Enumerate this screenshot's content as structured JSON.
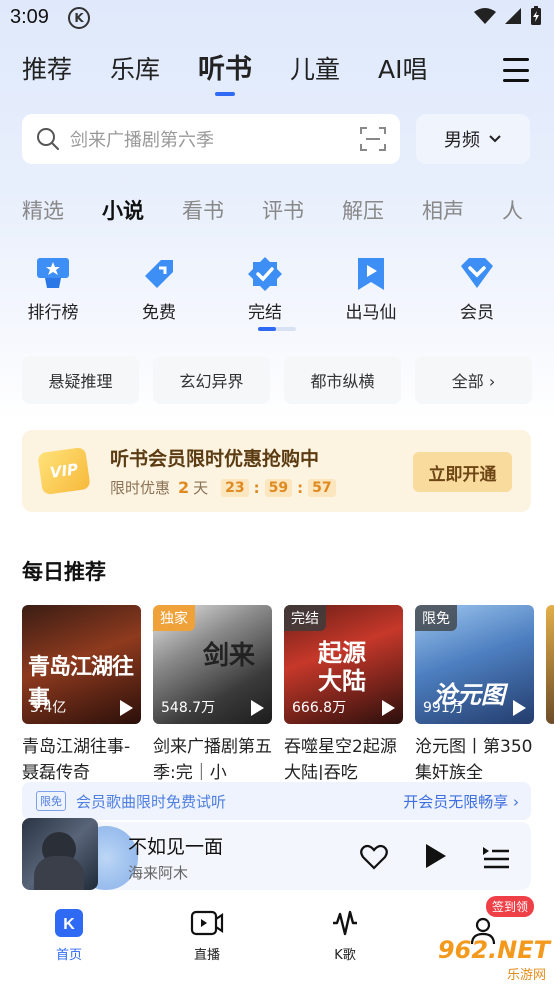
{
  "status": {
    "time": "3:09"
  },
  "top_tabs": [
    {
      "label": "推荐"
    },
    {
      "label": "乐库"
    },
    {
      "label": "听书"
    },
    {
      "label": "儿童"
    },
    {
      "label": "AI唱"
    }
  ],
  "search": {
    "placeholder": "剑来广播剧第六季"
  },
  "gender_filter": {
    "label": "男频"
  },
  "sub_tabs": [
    {
      "label": "精选"
    },
    {
      "label": "小说"
    },
    {
      "label": "看书"
    },
    {
      "label": "评书"
    },
    {
      "label": "解压"
    },
    {
      "label": "相声"
    },
    {
      "label": "人"
    }
  ],
  "categories": [
    {
      "label": "排行榜",
      "icon": "ranking-icon"
    },
    {
      "label": "免费",
      "icon": "free-tag-icon"
    },
    {
      "label": "完结",
      "icon": "finished-check-icon"
    },
    {
      "label": "出马仙",
      "icon": "bookmark-play-icon"
    },
    {
      "label": "会员",
      "icon": "vip-diamond-icon"
    }
  ],
  "chips": [
    {
      "label": "悬疑推理"
    },
    {
      "label": "玄幻异界"
    },
    {
      "label": "都市纵横"
    },
    {
      "label": "全部 ›"
    }
  ],
  "vip_banner": {
    "card_text": "VIP",
    "title": "听书会员限时优惠抢购中",
    "sub_label": "限时优惠",
    "days": "2",
    "days_unit": "天",
    "hours": "23",
    "minutes": "59",
    "seconds": "57",
    "button": "立即开通"
  },
  "daily": {
    "title": "每日推荐",
    "books": [
      {
        "tag": "",
        "plays": "3.4亿",
        "title": "青岛江湖往事-聂磊传奇",
        "cover_text": "青岛江湖往事"
      },
      {
        "tag": "独家",
        "plays": "548.7万",
        "title": "剑来广播剧第五季:完｜小",
        "cover_text": "剑来"
      },
      {
        "tag": "完结",
        "plays": "666.8万",
        "title": "吞噬星空2起源大陆|吞吃",
        "cover_text": "起源大陆"
      },
      {
        "tag": "限免",
        "plays": "991万",
        "title": "沧元图丨第350集奸族全",
        "cover_text": "沧元图"
      }
    ]
  },
  "trial_bar": {
    "badge": "限免",
    "text": "会员歌曲限时免费试听",
    "link": "开会员无限畅享 ›"
  },
  "player": {
    "title": "不如见一面",
    "artist": "海来阿木"
  },
  "bottom_nav": [
    {
      "label": "首页",
      "icon": "home-k-icon"
    },
    {
      "label": "直播",
      "icon": "live-video-icon"
    },
    {
      "label": "K歌",
      "icon": "k-song-icon"
    },
    {
      "label": "",
      "icon": "profile-icon"
    }
  ],
  "sign_badge": "签到领",
  "watermark": {
    "text": "962.NET",
    "sub": "乐游网"
  },
  "colors": {
    "accent": "#2f6af4",
    "vip_orange": "#e0891e",
    "vip_bg": "#fdf3e1"
  }
}
